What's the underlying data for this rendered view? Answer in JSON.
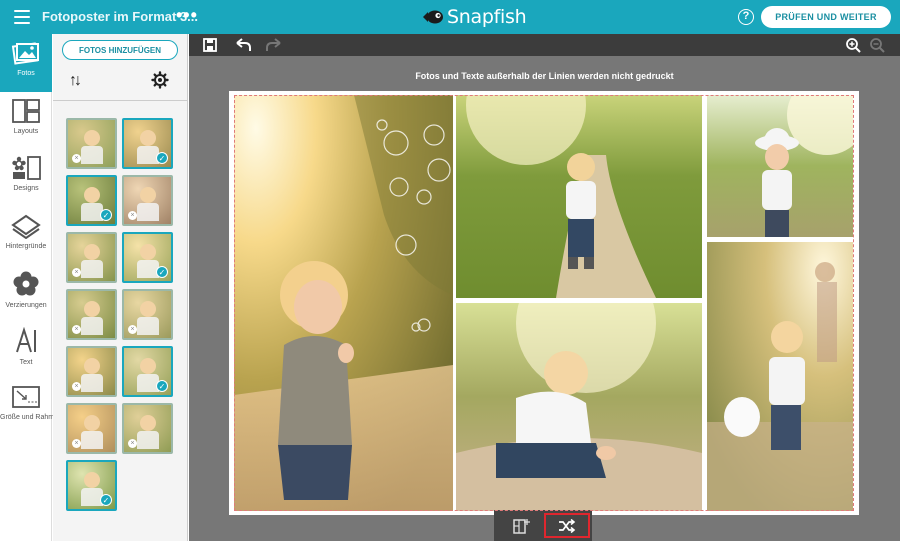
{
  "header": {
    "doc_title": "Fotoposter im Format 3...",
    "more": "•••",
    "brand": "Snapfish",
    "help": "?",
    "cta_label": "PRÜFEN UND WEITER"
  },
  "rail": {
    "items": [
      {
        "label": "Fotos",
        "icon": "photos-icon",
        "active": true
      },
      {
        "label": "Layouts",
        "icon": "layouts-icon"
      },
      {
        "label": "Designs",
        "icon": "designs-icon"
      },
      {
        "label": "Hintergründe",
        "icon": "backgrounds-icon"
      },
      {
        "label": "Verzierungen",
        "icon": "embellishments-icon"
      },
      {
        "label": "Text",
        "icon": "text-icon"
      },
      {
        "label": "Größe und Rahmen",
        "icon": "size-frame-icon"
      }
    ]
  },
  "panel": {
    "add_label": "FOTOS HINZUFÜGEN",
    "sort_glyph": "↑↓",
    "thumbnails": [
      {
        "selected": false
      },
      {
        "selected": true
      },
      {
        "selected": true
      },
      {
        "selected": false
      },
      {
        "selected": false
      },
      {
        "selected": true
      },
      {
        "selected": false
      },
      {
        "selected": false
      },
      {
        "selected": false
      },
      {
        "selected": true
      },
      {
        "selected": false
      },
      {
        "selected": false
      },
      {
        "selected": true
      }
    ]
  },
  "canvas": {
    "notice": "Fotos und Texte außerhalb der Linien werden nicht gedruckt"
  },
  "colors": {
    "accent": "#1aa7bd",
    "highlight": "#e0262e",
    "workspace": "#777777"
  }
}
